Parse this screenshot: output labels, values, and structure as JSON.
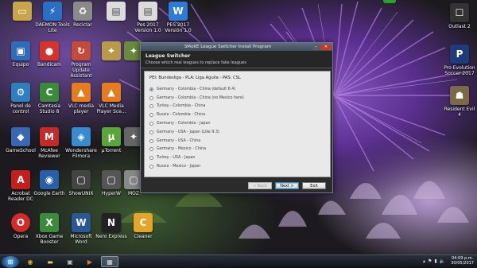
{
  "desktop_icons_left": [
    {
      "label": "",
      "icon": "folder-icon",
      "color": "#c8a54a"
    },
    {
      "label": "DAEMON Tools Lite",
      "icon": "daemon-tools-icon",
      "color": "#2a6fc4"
    },
    {
      "label": "Reciclar",
      "icon": "recycle-bin-icon",
      "color": "#8a8a8a"
    },
    {
      "label": "",
      "icon": "file-icon",
      "color": "#dcdcdc"
    },
    {
      "label": "Pes 2017 Version 1.0",
      "icon": "file-icon",
      "color": "#dcdcdc"
    },
    {
      "label": "PES 2017 Versión 1.0",
      "icon": "doc-icon",
      "color": "#2d7bd4"
    }
  ],
  "desktop_rows": [
    [
      {
        "label": "Equipo",
        "icon": "computer-icon",
        "color": "#2e6bb8"
      },
      {
        "label": "Bandicam",
        "icon": "bandicam-icon",
        "color": "#d6332b"
      },
      {
        "label": "Program Update Assistant",
        "icon": "update-icon",
        "color": "#c44a3a"
      },
      {
        "label": "",
        "icon": "tool-icon",
        "color": "#b89a4a"
      },
      {
        "label": "",
        "icon": "tool-icon",
        "color": "#6a8a3c"
      }
    ],
    [
      {
        "label": "Panel de control",
        "icon": "control-panel-icon",
        "color": "#2f7fbf"
      },
      {
        "label": "Camtasia Studio 8",
        "icon": "camtasia-icon",
        "color": "#3a8a3a"
      },
      {
        "label": "VLC media player",
        "icon": "vlc-icon",
        "color": "#e57c1e"
      },
      {
        "label": "VLC Media Player Sce...",
        "icon": "vlc-icon",
        "color": "#e57c1e"
      }
    ],
    [
      {
        "label": "GameSchool",
        "icon": "game-icon",
        "color": "#3a68b0"
      },
      {
        "label": "McAfee Reviewer",
        "icon": "mcafee-icon",
        "color": "#c42a2a"
      },
      {
        "label": "Wondershare Filmora",
        "icon": "filmora-icon",
        "color": "#3a8ad0"
      },
      {
        "label": "µTorrent",
        "icon": "utorrent-icon",
        "color": "#5aa63a"
      },
      {
        "label": "",
        "icon": "tool-icon",
        "color": "#666"
      }
    ],
    [
      {
        "label": "Acrobat Reader DC",
        "icon": "acrobat-icon",
        "color": "#c41e1e"
      },
      {
        "label": "Google Earth",
        "icon": "earth-icon",
        "color": "#2a5ea6"
      },
      {
        "label": "ShowUNIX",
        "icon": "app-icon",
        "color": "#444"
      },
      {
        "label": "HyperW",
        "icon": "app-icon",
        "color": "#555"
      },
      {
        "label": "MOZ",
        "icon": "app-icon",
        "color": "#888"
      }
    ],
    [
      {
        "label": "Opera",
        "icon": "opera-icon",
        "color": "#d32a2a"
      },
      {
        "label": "Xbox Game Booster",
        "icon": "xbox-icon",
        "color": "#3c8a3c"
      },
      {
        "label": "Microsoft Word",
        "icon": "word-icon",
        "color": "#2b5797"
      },
      {
        "label": "Nero Express",
        "icon": "nero-icon",
        "color": "#222"
      },
      {
        "label": "Cleaner",
        "icon": "cleaner-icon",
        "color": "#e5a52a"
      }
    ]
  ],
  "desktop_icons_right": [
    {
      "label": "Outlast 2",
      "icon": "outlast-icon",
      "color": "#333"
    },
    {
      "label": "Pro Evolution Soccer 2017",
      "icon": "pes-icon",
      "color": "#1e3c7a"
    },
    {
      "label": "Resident Evil 4",
      "icon": "re4-icon",
      "color": "#7a6a4a"
    }
  ],
  "dialog": {
    "title": "SMoKE League Switcher Install Program",
    "header_title": "League Switcher",
    "header_subtitle": "Choose which real leagues to replace fake leagues",
    "leagues_line": "PEI: Bundesliga - PLA: Liga Aguila - PAS: CSL",
    "options": [
      {
        "label": "Germany - Colombia - China (default 6.4)",
        "selected": true
      },
      {
        "label": "Germany - Colombia - China (no Mexico here)",
        "selected": false
      },
      {
        "label": "Turkey - Colombia - China",
        "selected": false
      },
      {
        "label": "Russia - Colombia - China",
        "selected": false
      },
      {
        "label": "Germany - Colombia - Japan",
        "selected": false
      },
      {
        "label": "Germany - USA - Japan (Like 9.3)",
        "selected": false
      },
      {
        "label": "Germany - USA - China",
        "selected": false
      },
      {
        "label": "Germany - Mexico - China",
        "selected": false
      },
      {
        "label": "Turkey - USA - Japan",
        "selected": false
      },
      {
        "label": "Russia - Mexico - Japan",
        "selected": false
      }
    ],
    "back_label": "< Back",
    "next_label": "Next >",
    "exit_label": "Exit"
  },
  "taskbar": {
    "time": "04:09 p.m.",
    "date": "30/05/2017"
  }
}
